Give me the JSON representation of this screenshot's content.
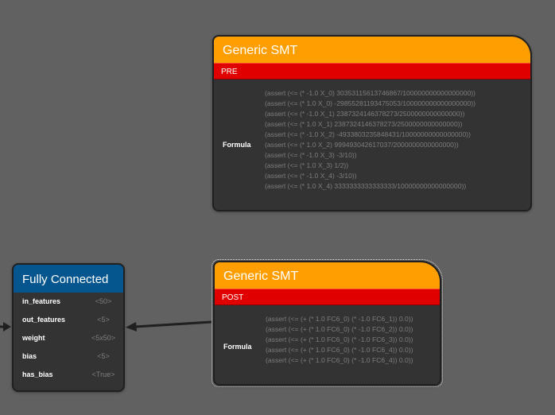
{
  "nodes": {
    "pre": {
      "title": "Generic SMT",
      "subtitle": "PRE",
      "formula_label": "Formula",
      "formula_lines": [
        "(assert (<= (* -1.0 X_0) 30353115613746867/100000000000000000))",
        "(assert (<= (* 1.0 X_0) -29855281193475053/100000000000000000))",
        "(assert (<= (* -1.0 X_1) 2387324146378273/2500000000000000))",
        "(assert (<= (* 1.0 X_1) 2387324146378273/2500000000000000))",
        "(assert (<= (* -1.0 X_2) -4933803235848431/10000000000000000))",
        "(assert (<= (* 1.0 X_2) 999493042617037/2000000000000000))",
        "(assert (<= (* -1.0 X_3) -3/10))",
        "(assert (<= (* 1.0 X_3) 1/2))",
        "(assert (<= (* -1.0 X_4) -3/10))",
        "(assert (<= (* 1.0 X_4) 3333333333333333/10000000000000000))"
      ]
    },
    "post": {
      "title": "Generic SMT",
      "subtitle": "POST",
      "formula_label": "Formula",
      "formula_lines": [
        "(assert (<= (+ (* 1.0 FC6_0) (* -1.0 FC6_1)) 0.0))",
        "(assert (<= (+ (* 1.0 FC6_0) (* -1.0 FC6_2)) 0.0))",
        "(assert (<= (+ (* 1.0 FC6_0) (* -1.0 FC6_3)) 0.0))",
        "(assert (<= (+ (* 1.0 FC6_0) (* -1.0 FC6_4)) 0.0))",
        "(assert (<= (+ (* 1.0 FC6_0) (* -1.0 FC6_4)) 0.0))"
      ]
    },
    "fc": {
      "title": "Fully Connected",
      "properties": [
        {
          "key": "in_features",
          "value": "<50>"
        },
        {
          "key": "out_features",
          "value": "<5>"
        },
        {
          "key": "weight",
          "value": "<5x50>"
        },
        {
          "key": "bias",
          "value": "<5>"
        },
        {
          "key": "has_bias",
          "value": "<True>"
        }
      ]
    }
  },
  "colors": {
    "canvas": "#616161",
    "node_body": "#333333",
    "smt_header": "#ff9e00",
    "smt_subheader": "#e00000",
    "fc_header": "#05568e",
    "edge": "#202020"
  }
}
